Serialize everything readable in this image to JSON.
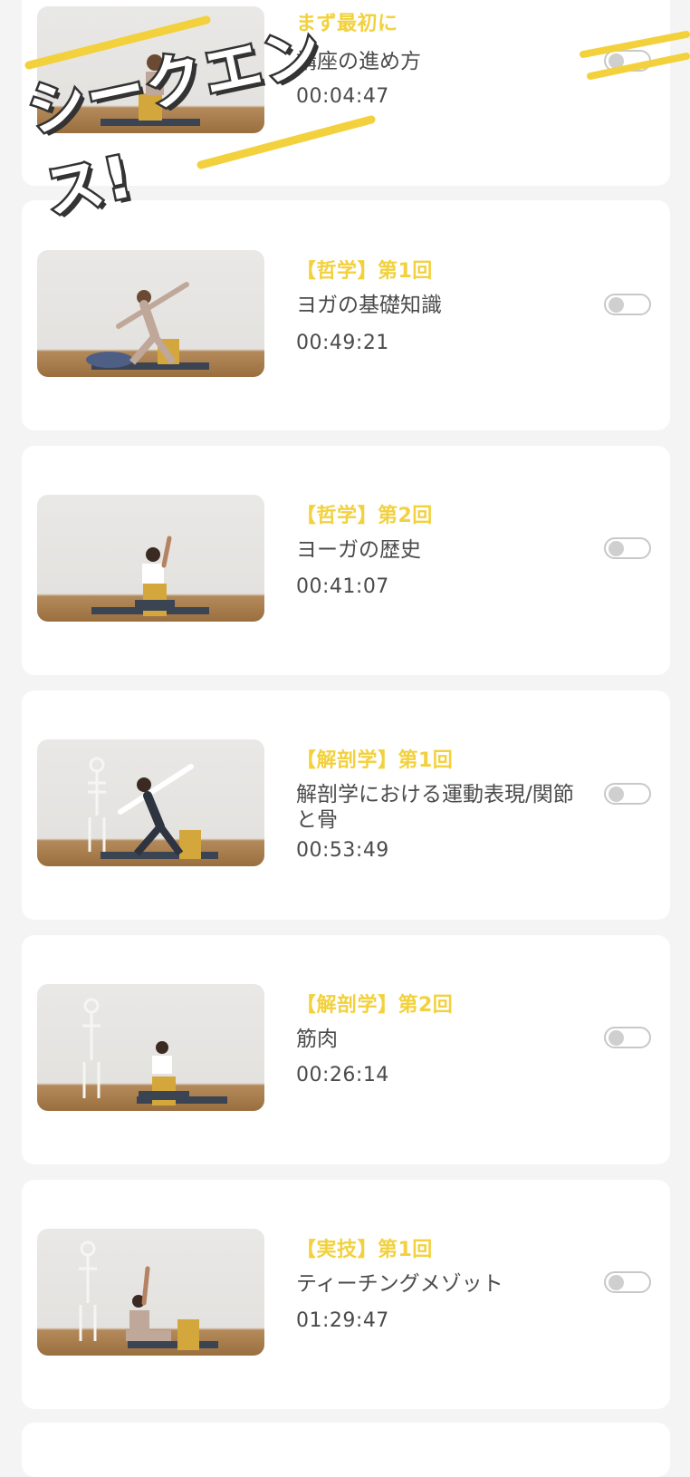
{
  "lessons": [
    {
      "category": "まず最初に",
      "title": "講座の進め方",
      "duration": "00:04:47",
      "toggle_on": false
    },
    {
      "category": "【哲学】第1回",
      "title": "ヨガの基礎知識",
      "duration": "00:49:21",
      "toggle_on": false
    },
    {
      "category": "【哲学】第2回",
      "title": "ヨーガの歴史",
      "duration": "00:41:07",
      "toggle_on": false
    },
    {
      "category": "【解剖学】第1回",
      "title": "解剖学における運動表現/関節と骨",
      "duration": "00:53:49",
      "toggle_on": false
    },
    {
      "category": "【解剖学】第2回",
      "title": "筋肉",
      "duration": "00:26:14",
      "toggle_on": false
    },
    {
      "category": "【実技】第1回",
      "title": "ティーチングメゾット",
      "duration": "01:29:47",
      "toggle_on": false
    }
  ],
  "overlay": {
    "text": "シークエンス!",
    "accent_color": "#f2d13d"
  },
  "colors": {
    "accent": "#f2d13d",
    "text": "#4b4b4b",
    "background": "#f4f4f4",
    "card": "#ffffff"
  },
  "icons": {
    "toggle": "toggle-switch-icon"
  }
}
